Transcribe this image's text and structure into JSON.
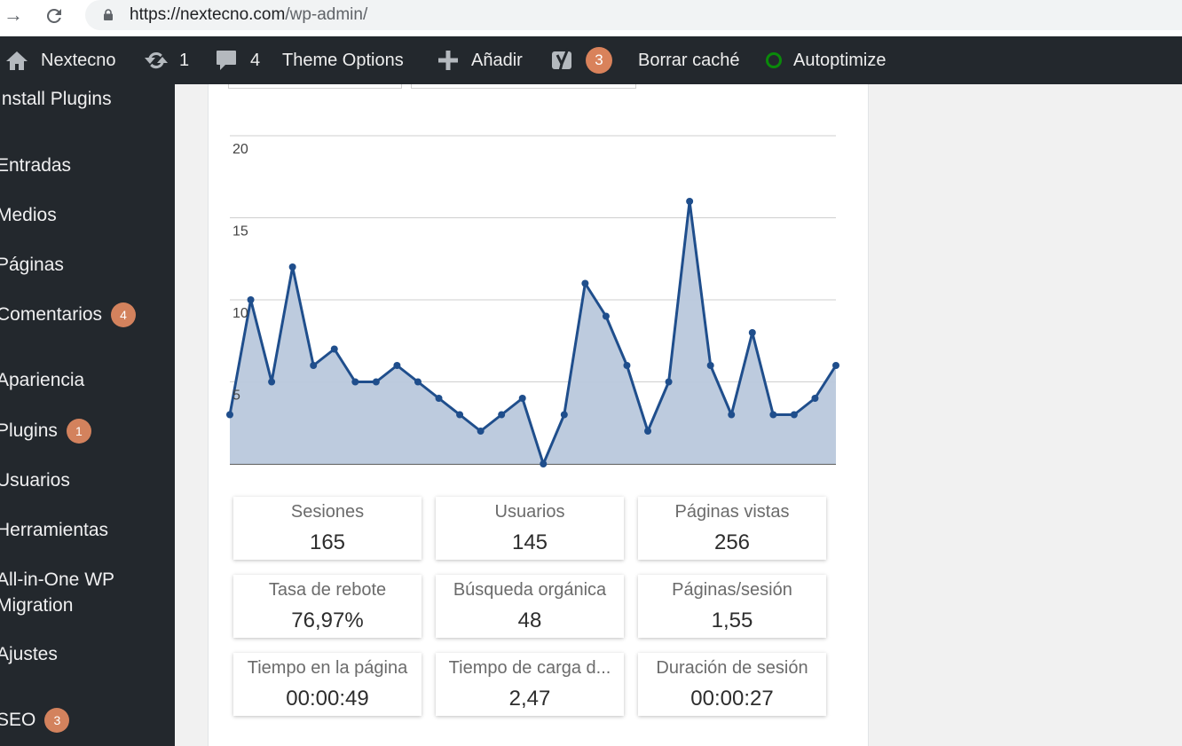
{
  "browser": {
    "url_host": "https://nextecno.com",
    "url_path": "/wp-admin/"
  },
  "adminbar": {
    "site_name": "Nextecno",
    "updates_count": "1",
    "comments_count": "4",
    "theme_options": "Theme Options",
    "add_new": "Añadir",
    "yoast_badge": "3",
    "clear_cache": "Borrar caché",
    "autoptimize": "Autoptimize"
  },
  "sidebar": {
    "items": [
      {
        "label": "Install Plugins"
      },
      {
        "label": "Entradas"
      },
      {
        "label": "Medios"
      },
      {
        "label": "Páginas"
      },
      {
        "label": "Comentarios",
        "badge": "4"
      },
      {
        "label": "Apariencia"
      },
      {
        "label": "Plugins",
        "badge": "1"
      },
      {
        "label": "Usuarios"
      },
      {
        "label": "Herramientas"
      },
      {
        "label": "All-in-One WP"
      },
      {
        "label": "Migration"
      },
      {
        "label": "Ajustes"
      },
      {
        "label": "SEO",
        "badge": "3"
      }
    ]
  },
  "chart_data": {
    "type": "area",
    "ylim": [
      0,
      20
    ],
    "yticks": [
      "20",
      "15",
      "10",
      "5"
    ],
    "color": "#1f4e8c",
    "fill": "#b9c8dc",
    "values": [
      3,
      10,
      5,
      12,
      6,
      7,
      5,
      5,
      6,
      5,
      4,
      3,
      2,
      3,
      4,
      0,
      3,
      11,
      9,
      6,
      2,
      5,
      16,
      6,
      3,
      8,
      3,
      3,
      4,
      6
    ]
  },
  "stats": [
    {
      "label": "Sesiones",
      "value": "165"
    },
    {
      "label": "Usuarios",
      "value": "145"
    },
    {
      "label": "Páginas vistas",
      "value": "256"
    },
    {
      "label": "Tasa de rebote",
      "value": "76,97%"
    },
    {
      "label": "Búsqueda orgánica",
      "value": "48"
    },
    {
      "label": "Páginas/sesión",
      "value": "1,55"
    },
    {
      "label": "Tiempo en la página",
      "value": "00:00:49"
    },
    {
      "label": "Tiempo de carga d...",
      "value": "2,47"
    },
    {
      "label": "Duración de sesión",
      "value": "00:00:27"
    }
  ]
}
